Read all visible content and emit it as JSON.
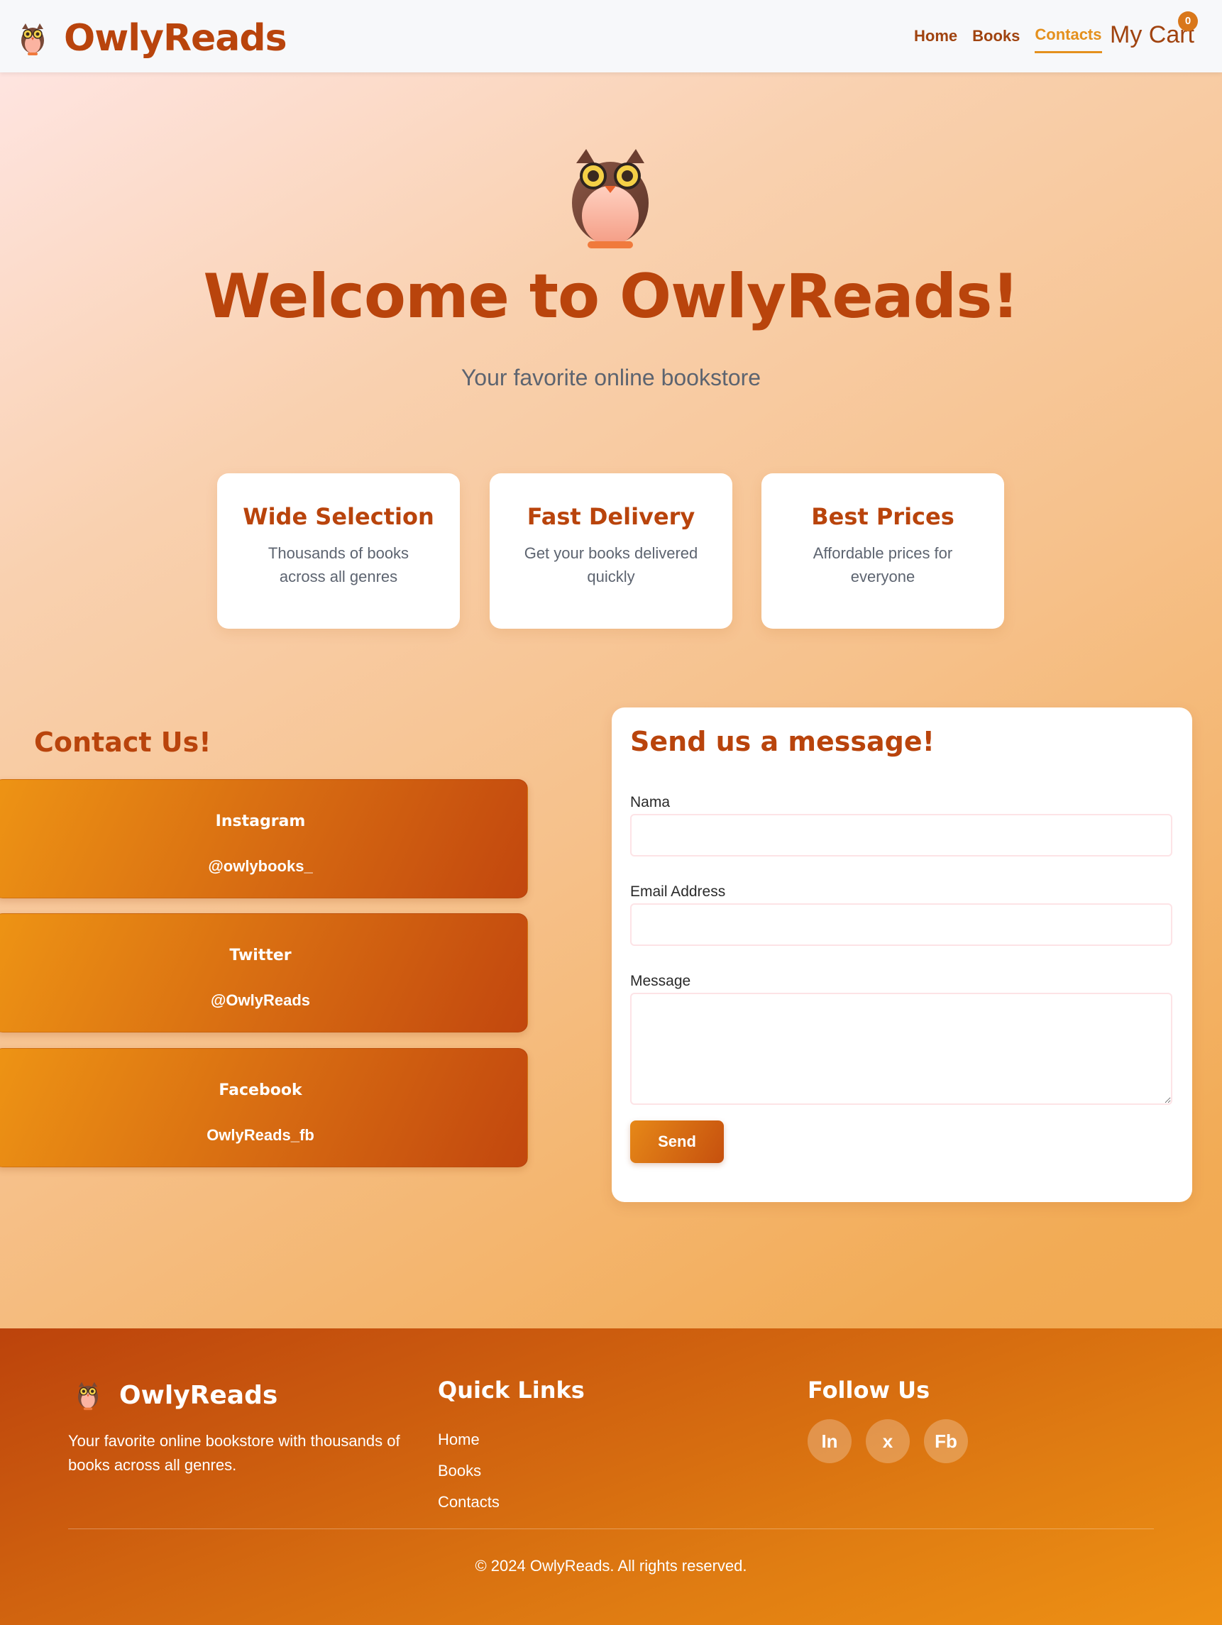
{
  "navbar": {
    "brand": "OwlyReads",
    "links": [
      {
        "label": "Home",
        "active": false
      },
      {
        "label": "Books",
        "active": false
      },
      {
        "label": "Contacts",
        "active": true
      }
    ],
    "cart_label": "My Cart",
    "cart_count": "0"
  },
  "hero": {
    "title": "Welcome to OwlyReads!",
    "subtitle": "Your favorite online bookstore"
  },
  "features": [
    {
      "title": "Wide Selection",
      "desc": "Thousands of books across all genres"
    },
    {
      "title": "Fast Delivery",
      "desc": "Get your books delivered quickly"
    },
    {
      "title": "Best Prices",
      "desc": "Affordable prices for everyone"
    }
  ],
  "contact": {
    "title": "Contact Us!",
    "socials": [
      {
        "name": "Instagram",
        "handle": "@owlybooks_"
      },
      {
        "name": "Twitter",
        "handle": "@OwlyReads"
      },
      {
        "name": "Facebook",
        "handle": "OwlyReads_fb"
      }
    ]
  },
  "form": {
    "title": "Send us a message!",
    "name_label": "Nama",
    "name_value": "",
    "email_label": "Email Address",
    "email_value": "",
    "message_label": "Message",
    "message_value": "",
    "submit_label": "Send"
  },
  "footer": {
    "brand": "OwlyReads",
    "desc": "Your favorite online bookstore with thousands of books across all genres.",
    "quick_links_title": "Quick Links",
    "quick_links": [
      "Home",
      "Books",
      "Contacts"
    ],
    "follow_title": "Follow Us",
    "follow_icons": [
      "In",
      "x",
      "Fb"
    ],
    "copyright": "© 2024 OwlyReads. All rights reserved."
  },
  "colors": {
    "brand": "#b9440c",
    "accent": "#e4901d",
    "footer_start": "#bc430c",
    "footer_end": "#ee9114"
  }
}
